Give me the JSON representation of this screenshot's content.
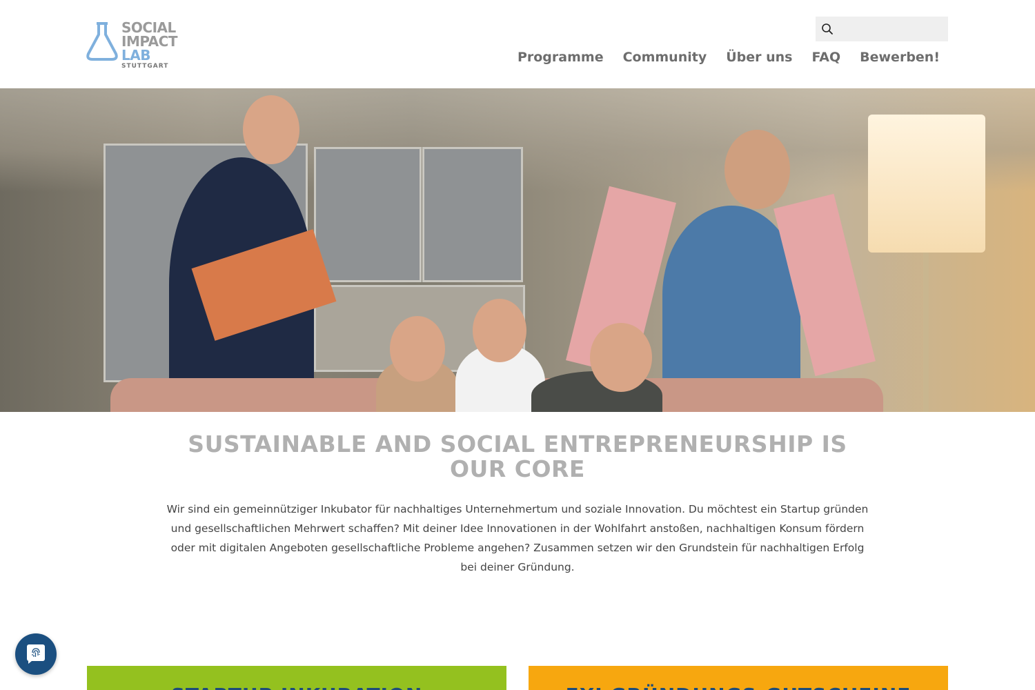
{
  "logo": {
    "line1": "SOCIAL",
    "line2": "IMPACT",
    "line3": "LAB",
    "line4": "STUTTGART",
    "icon": "flask-icon",
    "colors": {
      "grey": "#9a9a9a",
      "blue": "#7fb0dd"
    }
  },
  "search": {
    "placeholder": "",
    "icon": "search-icon"
  },
  "nav": {
    "items": [
      {
        "label": "Programme"
      },
      {
        "label": "Community"
      },
      {
        "label": "Über uns"
      },
      {
        "label": "FAQ"
      },
      {
        "label": "Bewerben!"
      }
    ]
  },
  "hero": {
    "image": "team-photo"
  },
  "main": {
    "headline": "SUSTAINABLE AND SOCIAL ENTREPRENEURSHIP IS OUR CORE",
    "intro": "Wir sind ein gemeinnütziger Inkubator für nachhaltiges Unternehmertum und soziale Innovation. Du möchtest ein Startup gründen und gesellschaftlichen Mehrwert schaffen? Mit deiner Idee Innovationen in der Wohlfahrt anstoßen, nachhaltigen Konsum fördern oder mit digitalen Angeboten gesellschaftliche Probleme angehen? Zusammen setzen wir den Grundstein für nachhaltigen Erfolg bei deiner Gründung."
  },
  "cards": [
    {
      "label": "STARTUP INKUBATION",
      "color": "#94c11f"
    },
    {
      "label": "EXI GRÜNDUNGS-GUTSCHEINE",
      "color": "#f7a70f"
    }
  ],
  "privacy_badge": {
    "icon": "fingerprint-icon",
    "color": "#1b4f80"
  }
}
